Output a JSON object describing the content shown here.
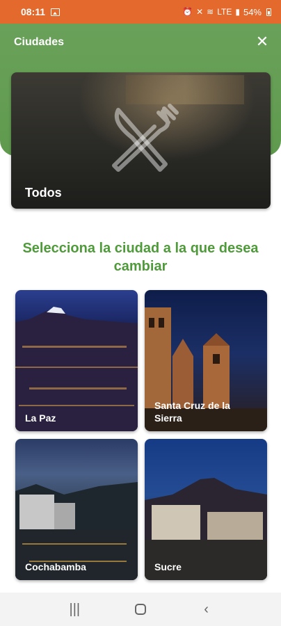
{
  "status_bar": {
    "time": "08:11",
    "network": "LTE",
    "battery": "54%"
  },
  "header": {
    "title": "Ciudades",
    "close_icon": "close-icon",
    "accent_color": "#5f9a4e"
  },
  "all_card": {
    "label": "Todos",
    "icon": "utensils-icon"
  },
  "section": {
    "title": "Selecciona la ciudad a la que desea cambiar",
    "title_color": "#4f9a3a"
  },
  "cities": [
    {
      "name": "La Paz"
    },
    {
      "name": "Santa Cruz de la Sierra"
    },
    {
      "name": "Cochabamba"
    },
    {
      "name": "Sucre"
    }
  ],
  "nav_bar": {
    "recents_icon": "recents-icon",
    "home_icon": "home-icon",
    "back_icon": "back-icon"
  }
}
